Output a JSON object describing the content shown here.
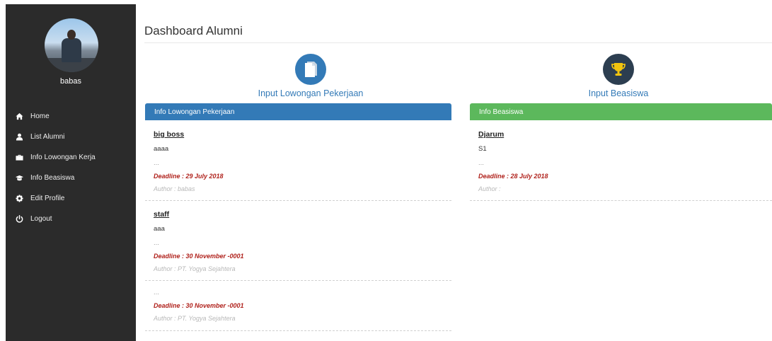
{
  "sidebar": {
    "username": "babas",
    "nav": [
      {
        "label": "Home",
        "icon": "home-icon"
      },
      {
        "label": "List Alumni",
        "icon": "user-icon"
      },
      {
        "label": "Info Lowongan Kerja",
        "icon": "briefcase-icon"
      },
      {
        "label": "Info Beasiswa",
        "icon": "graduation-cap-icon"
      },
      {
        "label": "Edit Profile",
        "icon": "gear-icon"
      },
      {
        "label": "Logout",
        "icon": "power-icon"
      }
    ]
  },
  "main": {
    "title": "Dashboard Alumni",
    "quick_links": {
      "job": {
        "label": "Input Lowongan Pekerjaan",
        "icon": "document-icon",
        "color": "#337ab7"
      },
      "scholarship": {
        "label": "Input Beasiswa",
        "icon": "trophy-icon",
        "color": "#2c3e50"
      }
    },
    "job_panel": {
      "heading": "Info Lowongan Pekerjaan",
      "color": "#337ab7",
      "posts": [
        {
          "title": "big boss",
          "desc": "aaaa",
          "more": "...",
          "deadline": "Deadline : 29 July 2018",
          "author": "Author : babas"
        },
        {
          "title": "staff",
          "desc": "aaa",
          "more": "...",
          "deadline": "Deadline : 30 November -0001",
          "author": "Author : PT. Yogya Sejahtera"
        },
        {
          "title": "",
          "desc": "",
          "more": "...",
          "deadline": "Deadline : 30 November -0001",
          "author": "Author : PT. Yogya Sejahtera"
        }
      ]
    },
    "scholarship_panel": {
      "heading": "Info Beasiswa",
      "color": "#5cb85c",
      "posts": [
        {
          "title": "Djarum",
          "desc": "S1",
          "more": "...",
          "deadline": "Deadline : 28 July 2018",
          "author": "Author :"
        }
      ]
    }
  }
}
